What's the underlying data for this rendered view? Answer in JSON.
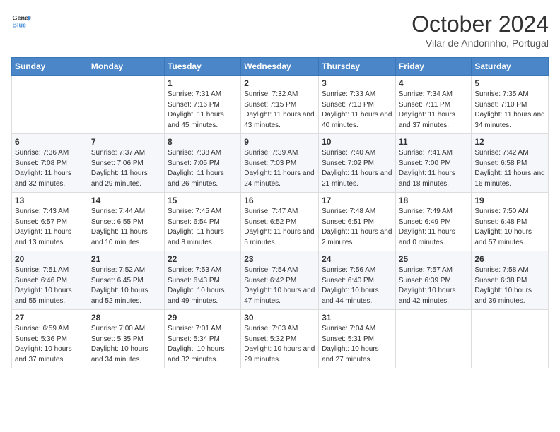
{
  "header": {
    "logo_line1": "General",
    "logo_line2": "Blue",
    "month_title": "October 2024",
    "location": "Vilar de Andorinho, Portugal"
  },
  "weekdays": [
    "Sunday",
    "Monday",
    "Tuesday",
    "Wednesday",
    "Thursday",
    "Friday",
    "Saturday"
  ],
  "weeks": [
    [
      {
        "day": "",
        "sunrise": "",
        "sunset": "",
        "daylight": ""
      },
      {
        "day": "",
        "sunrise": "",
        "sunset": "",
        "daylight": ""
      },
      {
        "day": "1",
        "sunrise": "Sunrise: 7:31 AM",
        "sunset": "Sunset: 7:16 PM",
        "daylight": "Daylight: 11 hours and 45 minutes."
      },
      {
        "day": "2",
        "sunrise": "Sunrise: 7:32 AM",
        "sunset": "Sunset: 7:15 PM",
        "daylight": "Daylight: 11 hours and 43 minutes."
      },
      {
        "day": "3",
        "sunrise": "Sunrise: 7:33 AM",
        "sunset": "Sunset: 7:13 PM",
        "daylight": "Daylight: 11 hours and 40 minutes."
      },
      {
        "day": "4",
        "sunrise": "Sunrise: 7:34 AM",
        "sunset": "Sunset: 7:11 PM",
        "daylight": "Daylight: 11 hours and 37 minutes."
      },
      {
        "day": "5",
        "sunrise": "Sunrise: 7:35 AM",
        "sunset": "Sunset: 7:10 PM",
        "daylight": "Daylight: 11 hours and 34 minutes."
      }
    ],
    [
      {
        "day": "6",
        "sunrise": "Sunrise: 7:36 AM",
        "sunset": "Sunset: 7:08 PM",
        "daylight": "Daylight: 11 hours and 32 minutes."
      },
      {
        "day": "7",
        "sunrise": "Sunrise: 7:37 AM",
        "sunset": "Sunset: 7:06 PM",
        "daylight": "Daylight: 11 hours and 29 minutes."
      },
      {
        "day": "8",
        "sunrise": "Sunrise: 7:38 AM",
        "sunset": "Sunset: 7:05 PM",
        "daylight": "Daylight: 11 hours and 26 minutes."
      },
      {
        "day": "9",
        "sunrise": "Sunrise: 7:39 AM",
        "sunset": "Sunset: 7:03 PM",
        "daylight": "Daylight: 11 hours and 24 minutes."
      },
      {
        "day": "10",
        "sunrise": "Sunrise: 7:40 AM",
        "sunset": "Sunset: 7:02 PM",
        "daylight": "Daylight: 11 hours and 21 minutes."
      },
      {
        "day": "11",
        "sunrise": "Sunrise: 7:41 AM",
        "sunset": "Sunset: 7:00 PM",
        "daylight": "Daylight: 11 hours and 18 minutes."
      },
      {
        "day": "12",
        "sunrise": "Sunrise: 7:42 AM",
        "sunset": "Sunset: 6:58 PM",
        "daylight": "Daylight: 11 hours and 16 minutes."
      }
    ],
    [
      {
        "day": "13",
        "sunrise": "Sunrise: 7:43 AM",
        "sunset": "Sunset: 6:57 PM",
        "daylight": "Daylight: 11 hours and 13 minutes."
      },
      {
        "day": "14",
        "sunrise": "Sunrise: 7:44 AM",
        "sunset": "Sunset: 6:55 PM",
        "daylight": "Daylight: 11 hours and 10 minutes."
      },
      {
        "day": "15",
        "sunrise": "Sunrise: 7:45 AM",
        "sunset": "Sunset: 6:54 PM",
        "daylight": "Daylight: 11 hours and 8 minutes."
      },
      {
        "day": "16",
        "sunrise": "Sunrise: 7:47 AM",
        "sunset": "Sunset: 6:52 PM",
        "daylight": "Daylight: 11 hours and 5 minutes."
      },
      {
        "day": "17",
        "sunrise": "Sunrise: 7:48 AM",
        "sunset": "Sunset: 6:51 PM",
        "daylight": "Daylight: 11 hours and 2 minutes."
      },
      {
        "day": "18",
        "sunrise": "Sunrise: 7:49 AM",
        "sunset": "Sunset: 6:49 PM",
        "daylight": "Daylight: 11 hours and 0 minutes."
      },
      {
        "day": "19",
        "sunrise": "Sunrise: 7:50 AM",
        "sunset": "Sunset: 6:48 PM",
        "daylight": "Daylight: 10 hours and 57 minutes."
      }
    ],
    [
      {
        "day": "20",
        "sunrise": "Sunrise: 7:51 AM",
        "sunset": "Sunset: 6:46 PM",
        "daylight": "Daylight: 10 hours and 55 minutes."
      },
      {
        "day": "21",
        "sunrise": "Sunrise: 7:52 AM",
        "sunset": "Sunset: 6:45 PM",
        "daylight": "Daylight: 10 hours and 52 minutes."
      },
      {
        "day": "22",
        "sunrise": "Sunrise: 7:53 AM",
        "sunset": "Sunset: 6:43 PM",
        "daylight": "Daylight: 10 hours and 49 minutes."
      },
      {
        "day": "23",
        "sunrise": "Sunrise: 7:54 AM",
        "sunset": "Sunset: 6:42 PM",
        "daylight": "Daylight: 10 hours and 47 minutes."
      },
      {
        "day": "24",
        "sunrise": "Sunrise: 7:56 AM",
        "sunset": "Sunset: 6:40 PM",
        "daylight": "Daylight: 10 hours and 44 minutes."
      },
      {
        "day": "25",
        "sunrise": "Sunrise: 7:57 AM",
        "sunset": "Sunset: 6:39 PM",
        "daylight": "Daylight: 10 hours and 42 minutes."
      },
      {
        "day": "26",
        "sunrise": "Sunrise: 7:58 AM",
        "sunset": "Sunset: 6:38 PM",
        "daylight": "Daylight: 10 hours and 39 minutes."
      }
    ],
    [
      {
        "day": "27",
        "sunrise": "Sunrise: 6:59 AM",
        "sunset": "Sunset: 5:36 PM",
        "daylight": "Daylight: 10 hours and 37 minutes."
      },
      {
        "day": "28",
        "sunrise": "Sunrise: 7:00 AM",
        "sunset": "Sunset: 5:35 PM",
        "daylight": "Daylight: 10 hours and 34 minutes."
      },
      {
        "day": "29",
        "sunrise": "Sunrise: 7:01 AM",
        "sunset": "Sunset: 5:34 PM",
        "daylight": "Daylight: 10 hours and 32 minutes."
      },
      {
        "day": "30",
        "sunrise": "Sunrise: 7:03 AM",
        "sunset": "Sunset: 5:32 PM",
        "daylight": "Daylight: 10 hours and 29 minutes."
      },
      {
        "day": "31",
        "sunrise": "Sunrise: 7:04 AM",
        "sunset": "Sunset: 5:31 PM",
        "daylight": "Daylight: 10 hours and 27 minutes."
      },
      {
        "day": "",
        "sunrise": "",
        "sunset": "",
        "daylight": ""
      },
      {
        "day": "",
        "sunrise": "",
        "sunset": "",
        "daylight": ""
      }
    ]
  ]
}
